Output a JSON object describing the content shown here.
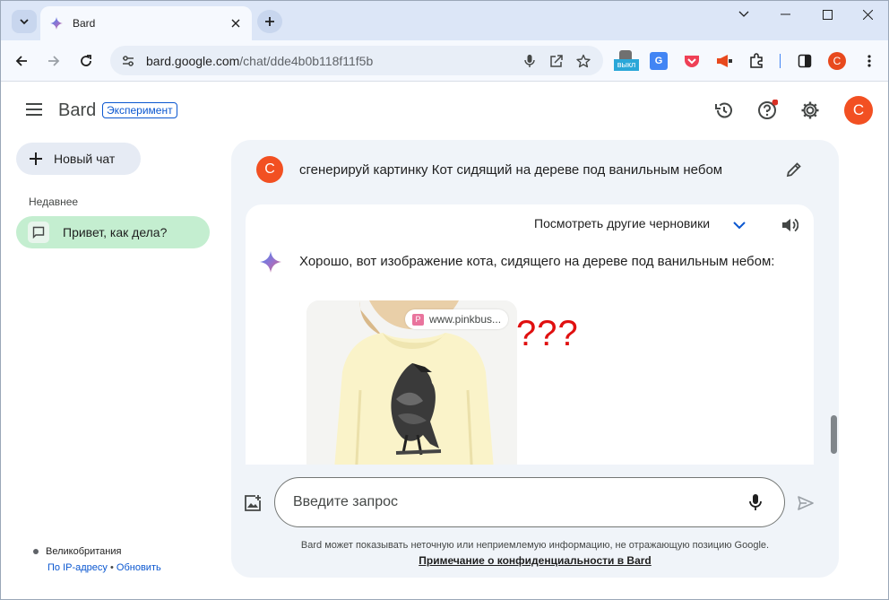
{
  "browser": {
    "tab_title": "Bard",
    "url_domain": "bard.google.com",
    "url_path": "/chat/dde4b0b118f11f5b",
    "extension_badge": "выкл",
    "profile_initial": "C"
  },
  "header": {
    "logo": "Bard",
    "badge": "Эксперимент",
    "user_initial": "C"
  },
  "sidebar": {
    "new_chat": "Новый чат",
    "recent_heading": "Недавнее",
    "recent_items": [
      {
        "label": "Привет, как дела?"
      }
    ],
    "location": {
      "country": "Великобритания",
      "source": "По IP-адресу",
      "separator": "•",
      "update": "Обновить"
    }
  },
  "chat": {
    "user_initial": "C",
    "prompt": "сгенерируй картинку Кот сидящий на дереве под ванильным небом",
    "drafts_label": "Посмотреть другие черновики",
    "response": "Хорошо, вот изображение кота, сидящего на дереве под ванильным небом:",
    "image_source": "www.pinkbus...",
    "image_source_icon": "P",
    "annotation": "???"
  },
  "input": {
    "placeholder": "Введите запрос"
  },
  "footer": {
    "disclaimer": "Bard может показывать неточную или неприемлемую информацию, не отражающую позицию Google.",
    "privacy_link": "Примечание о конфиденциальности в Bard"
  },
  "colors": {
    "tabstrip": "#dce6f7",
    "panel": "#f0f4f9",
    "accent": "#0b57d0",
    "avatar": "#f25022",
    "recent_active": "#c4eed0",
    "annotation": "#e01010"
  }
}
